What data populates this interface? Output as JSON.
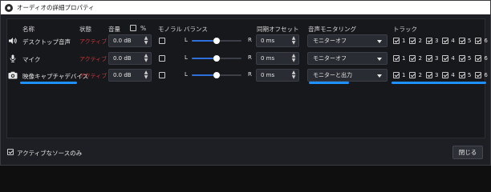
{
  "window": {
    "title": "オーディオの詳細プロパティ"
  },
  "headers": {
    "name": "名称",
    "status": "状態",
    "volume": "音量",
    "percent": "%",
    "mono": "モノラル",
    "balance": "バランス",
    "sync_offset": "同期オフセット",
    "monitoring": "音声モニタリング",
    "tracks": "トラック"
  },
  "rows": [
    {
      "icon": "speaker-icon",
      "name": "デスクトップ音声",
      "status": "アクティブ",
      "volume": "0.0 dB",
      "mono": false,
      "balance_left": "L",
      "balance_right": "R",
      "balance_level": 0.5,
      "sync": "0 ms",
      "monitoring": "モニターオフ",
      "tracks": [
        "1",
        "2",
        "3",
        "4",
        "5",
        "6"
      ]
    },
    {
      "icon": "microphone-icon",
      "name": "マイク",
      "status": "アクティブ",
      "volume": "0.0 dB",
      "mono": false,
      "balance_left": "L",
      "balance_right": "R",
      "balance_level": 0.5,
      "sync": "0 ms",
      "monitoring": "モニターオフ",
      "tracks": [
        "1",
        "2",
        "3",
        "4",
        "5",
        "6"
      ]
    },
    {
      "icon": "camera-icon",
      "name": "映像キャプチャデバイス",
      "status": "アクティブ",
      "volume": "0.0 dB",
      "mono": false,
      "balance_left": "L",
      "balance_right": "R",
      "balance_level": 0.5,
      "sync": "0 ms",
      "monitoring": "モニターと出力",
      "tracks": [
        "1",
        "2",
        "3",
        "4",
        "5",
        "6"
      ]
    }
  ],
  "footer": {
    "active_only_label": "アクティブなソースのみ",
    "close_label": "閉じる"
  },
  "colors": {
    "status_active": "#c23a3a",
    "accent_underline": "#1e90ff",
    "slider_fill": "#2f6fdc"
  }
}
